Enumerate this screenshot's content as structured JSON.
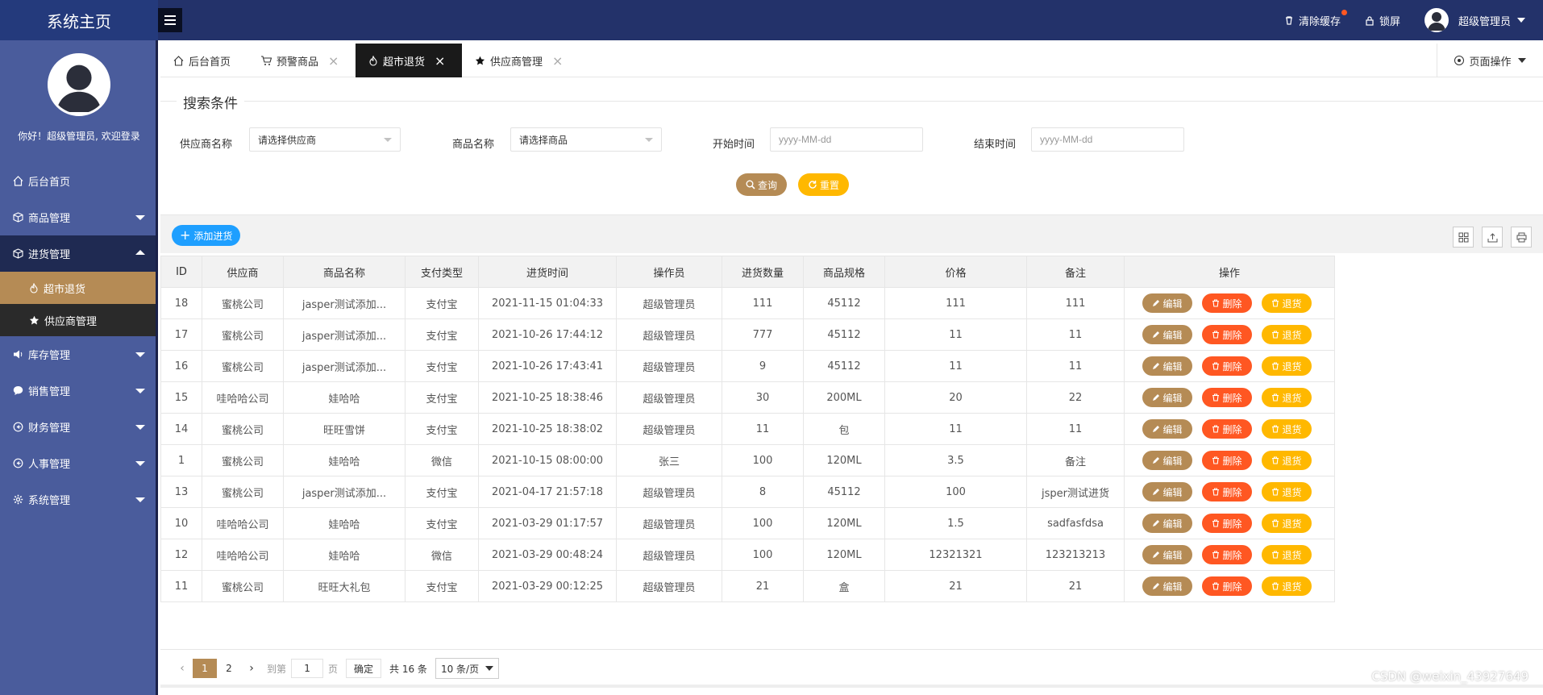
{
  "header": {
    "brand": "系统主页",
    "clear_cache": "清除缓存",
    "lock_screen": "锁屏",
    "user_name": "超级管理员"
  },
  "sidebar": {
    "welcome": "你好！超级管理员, 欢迎登录",
    "items": [
      {
        "label": "后台首页",
        "icon": "home-icon"
      },
      {
        "label": "商品管理",
        "icon": "cube-icon"
      },
      {
        "label": "进货管理",
        "icon": "cube-icon"
      },
      {
        "label": "库存管理",
        "icon": "speaker-icon"
      },
      {
        "label": "销售管理",
        "icon": "chat-icon"
      },
      {
        "label": "财务管理",
        "icon": "circle-arrow-icon"
      },
      {
        "label": "人事管理",
        "icon": "circle-arrow-icon"
      },
      {
        "label": "系统管理",
        "icon": "gear-icon"
      }
    ],
    "sub_items": [
      {
        "label": "超市退货",
        "icon": "fire-icon"
      },
      {
        "label": "供应商管理",
        "icon": "star-icon"
      }
    ]
  },
  "tabs": [
    {
      "label": "后台首页",
      "icon": "home-icon"
    },
    {
      "label": "预警商品",
      "icon": "cart-icon"
    },
    {
      "label": "超市退货",
      "icon": "fire-icon"
    },
    {
      "label": "供应商管理",
      "icon": "star-icon"
    }
  ],
  "page_ops": "页面操作",
  "search": {
    "legend": "搜索条件",
    "supplier_label": "供应商名称",
    "supplier_value": "请选择供应商",
    "product_label": "商品名称",
    "product_value": "请选择商品",
    "start_label": "开始时间",
    "start_placeholder": "yyyy-MM-dd",
    "end_label": "结束时间",
    "end_placeholder": "yyyy-MM-dd",
    "query_btn": "查询",
    "reset_btn": "重置"
  },
  "toolbar": {
    "add_btn": "添加进货"
  },
  "table": {
    "headers": [
      "ID",
      "供应商",
      "商品名称",
      "支付类型",
      "进货时间",
      "操作员",
      "进货数量",
      "商品规格",
      "价格",
      "备注",
      "操作"
    ],
    "rows": [
      [
        "18",
        "蜜桃公司",
        "jasper测试添加...",
        "支付宝",
        "2021-11-15 01:04:33",
        "超级管理员",
        "111",
        "45112",
        "111",
        "111"
      ],
      [
        "17",
        "蜜桃公司",
        "jasper测试添加...",
        "支付宝",
        "2021-10-26 17:44:12",
        "超级管理员",
        "777",
        "45112",
        "11",
        "11"
      ],
      [
        "16",
        "蜜桃公司",
        "jasper测试添加...",
        "支付宝",
        "2021-10-26 17:43:41",
        "超级管理员",
        "9",
        "45112",
        "11",
        "11"
      ],
      [
        "15",
        "哇哈哈公司",
        "娃哈哈",
        "支付宝",
        "2021-10-25 18:38:46",
        "超级管理员",
        "30",
        "200ML",
        "20",
        "22"
      ],
      [
        "14",
        "蜜桃公司",
        "旺旺雪饼",
        "支付宝",
        "2021-10-25 18:38:02",
        "超级管理员",
        "11",
        "包",
        "11",
        "11"
      ],
      [
        "1",
        "蜜桃公司",
        "娃哈哈",
        "微信",
        "2021-10-15 08:00:00",
        "张三",
        "100",
        "120ML",
        "3.5",
        "备注"
      ],
      [
        "13",
        "蜜桃公司",
        "jasper测试添加...",
        "支付宝",
        "2021-04-17 21:57:18",
        "超级管理员",
        "8",
        "45112",
        "100",
        "jsper测试进货"
      ],
      [
        "10",
        "哇哈哈公司",
        "娃哈哈",
        "支付宝",
        "2021-03-29 01:17:57",
        "超级管理员",
        "100",
        "120ML",
        "1.5",
        "sadfasfdsa"
      ],
      [
        "12",
        "哇哈哈公司",
        "娃哈哈",
        "微信",
        "2021-03-29 00:48:24",
        "超级管理员",
        "100",
        "120ML",
        "12321321",
        "123213213"
      ],
      [
        "11",
        "蜜桃公司",
        "旺旺大礼包",
        "支付宝",
        "2021-03-29 00:12:25",
        "超级管理员",
        "21",
        "盒",
        "21",
        "21"
      ]
    ],
    "actions": {
      "edit": "编辑",
      "delete": "删除",
      "return": "退货"
    }
  },
  "pager": {
    "page1": "1",
    "page2": "2",
    "goto_label": "到第",
    "goto_value": "1",
    "page_unit": "页",
    "confirm": "确定",
    "total": "共 16 条",
    "per_page": "10 条/页"
  },
  "watermark": "CSDN @weixin_43927649",
  "colors": {
    "header": "#23326a",
    "sidebar": "#4a5c9c",
    "accent": "#b58b55",
    "danger": "#ff5722",
    "warn": "#ffb800",
    "primary": "#1e9fff"
  }
}
